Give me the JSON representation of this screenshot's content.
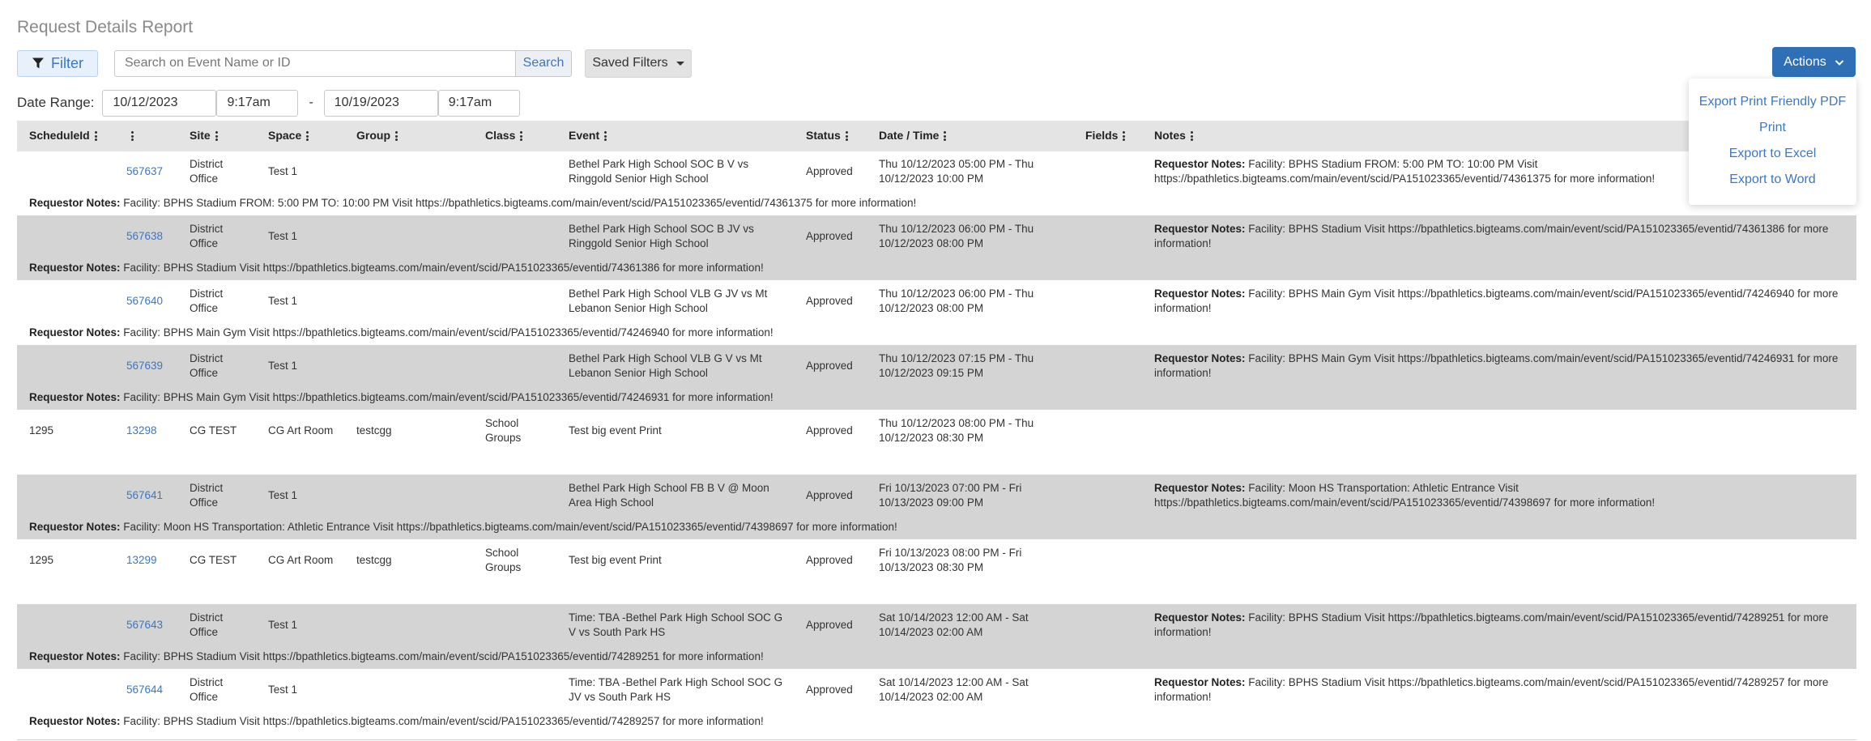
{
  "page": {
    "title": "Request Details Report"
  },
  "toolbar": {
    "filter_label": "Filter",
    "search_placeholder": "Search on Event Name or ID",
    "search_label": "Search",
    "saved_filters_label": "Saved Filters",
    "actions_label": "Actions"
  },
  "actions_menu": {
    "items": [
      "Export Print Friendly PDF",
      "Print",
      "Export to Excel",
      "Export to Word"
    ]
  },
  "date_range": {
    "label": "Date Range:",
    "start_date": "10/12/2023",
    "start_time": "9:17am",
    "separator": "-",
    "end_date": "10/19/2023",
    "end_time": "9:17am"
  },
  "table": {
    "columns": [
      "ScheduleId",
      "",
      "Site",
      "Space",
      "Group",
      "Class",
      "Event",
      "Status",
      "Date / Time",
      "Fields",
      "Notes"
    ],
    "note_label": "Requestor Notes:",
    "rows": [
      {
        "schedule_id": "",
        "id": "567637",
        "site": "District Office",
        "space": "Test 1",
        "group": "",
        "class": "",
        "event": "Bethel Park High School SOC B V vs Ringgold Senior High School",
        "status": "Approved",
        "datetime": "Thu 10/12/2023 05:00 PM - Thu 10/12/2023 10:00 PM",
        "fields": "",
        "notes": "Facility: BPHS Stadium FROM: 5:00 PM TO: 10:00 PM Visit https://bpathletics.bigteams.com/main/event/scid/PA151023365/eventid/74361375 for more information!",
        "shaded": false
      },
      {
        "schedule_id": "",
        "id": "567638",
        "site": "District Office",
        "space": "Test 1",
        "group": "",
        "class": "",
        "event": "Bethel Park High School SOC B JV vs Ringgold Senior High School",
        "status": "Approved",
        "datetime": "Thu 10/12/2023 06:00 PM - Thu 10/12/2023 08:00 PM",
        "fields": "",
        "notes": "Facility: BPHS Stadium Visit https://bpathletics.bigteams.com/main/event/scid/PA151023365/eventid/74361386 for more information!",
        "shaded": true
      },
      {
        "schedule_id": "",
        "id": "567640",
        "site": "District Office",
        "space": "Test 1",
        "group": "",
        "class": "",
        "event": "Bethel Park High School VLB G JV vs Mt Lebanon Senior High School",
        "status": "Approved",
        "datetime": "Thu 10/12/2023 06:00 PM - Thu 10/12/2023 08:00 PM",
        "fields": "",
        "notes": "Facility: BPHS Main Gym Visit https://bpathletics.bigteams.com/main/event/scid/PA151023365/eventid/74246940 for more information!",
        "shaded": false
      },
      {
        "schedule_id": "",
        "id": "567639",
        "site": "District Office",
        "space": "Test 1",
        "group": "",
        "class": "",
        "event": "Bethel Park High School VLB G V vs Mt Lebanon Senior High School",
        "status": "Approved",
        "datetime": "Thu 10/12/2023 07:15 PM - Thu 10/12/2023 09:15 PM",
        "fields": "",
        "notes": "Facility: BPHS Main Gym Visit https://bpathletics.bigteams.com/main/event/scid/PA151023365/eventid/74246931 for more information!",
        "shaded": true
      },
      {
        "schedule_id": "1295",
        "id": "13298",
        "site": "CG TEST",
        "space": "CG Art Room",
        "group": "testcgg",
        "class": "School Groups",
        "event": "Test big event Print",
        "status": "Approved",
        "datetime": "Thu 10/12/2023 08:00 PM - Thu 10/12/2023 08:30 PM",
        "fields": "",
        "notes": "",
        "shaded": false
      },
      {
        "schedule_id": "",
        "id": "567641",
        "site": "District Office",
        "space": "Test 1",
        "group": "",
        "class": "",
        "event": "Bethel Park High School FB B V @ Moon Area High School",
        "status": "Approved",
        "datetime": "Fri 10/13/2023 07:00 PM - Fri 10/13/2023 09:00 PM",
        "fields": "",
        "notes": "Facility: Moon HS Transportation: Athletic Entrance Visit https://bpathletics.bigteams.com/main/event/scid/PA151023365/eventid/74398697 for more information!",
        "shaded": true
      },
      {
        "schedule_id": "1295",
        "id": "13299",
        "site": "CG TEST",
        "space": "CG Art Room",
        "group": "testcgg",
        "class": "School Groups",
        "event": "Test big event Print",
        "status": "Approved",
        "datetime": "Fri 10/13/2023 08:00 PM - Fri 10/13/2023 08:30 PM",
        "fields": "",
        "notes": "",
        "shaded": false
      },
      {
        "schedule_id": "",
        "id": "567643",
        "site": "District Office",
        "space": "Test 1",
        "group": "",
        "class": "",
        "event": "Time: TBA -Bethel Park High School SOC G V vs South Park HS",
        "status": "Approved",
        "datetime": "Sat 10/14/2023 12:00 AM - Sat 10/14/2023 02:00 AM",
        "fields": "",
        "notes": "Facility: BPHS Stadium Visit https://bpathletics.bigteams.com/main/event/scid/PA151023365/eventid/74289251 for more information!",
        "shaded": true
      },
      {
        "schedule_id": "",
        "id": "567644",
        "site": "District Office",
        "space": "Test 1",
        "group": "",
        "class": "",
        "event": "Time: TBA -Bethel Park High School SOC G JV vs South Park HS",
        "status": "Approved",
        "datetime": "Sat 10/14/2023 12:00 AM - Sat 10/14/2023 02:00 AM",
        "fields": "",
        "notes": "Facility: BPHS Stadium Visit https://bpathletics.bigteams.com/main/event/scid/PA151023365/eventid/74289257 for more information!",
        "shaded": false
      }
    ]
  }
}
